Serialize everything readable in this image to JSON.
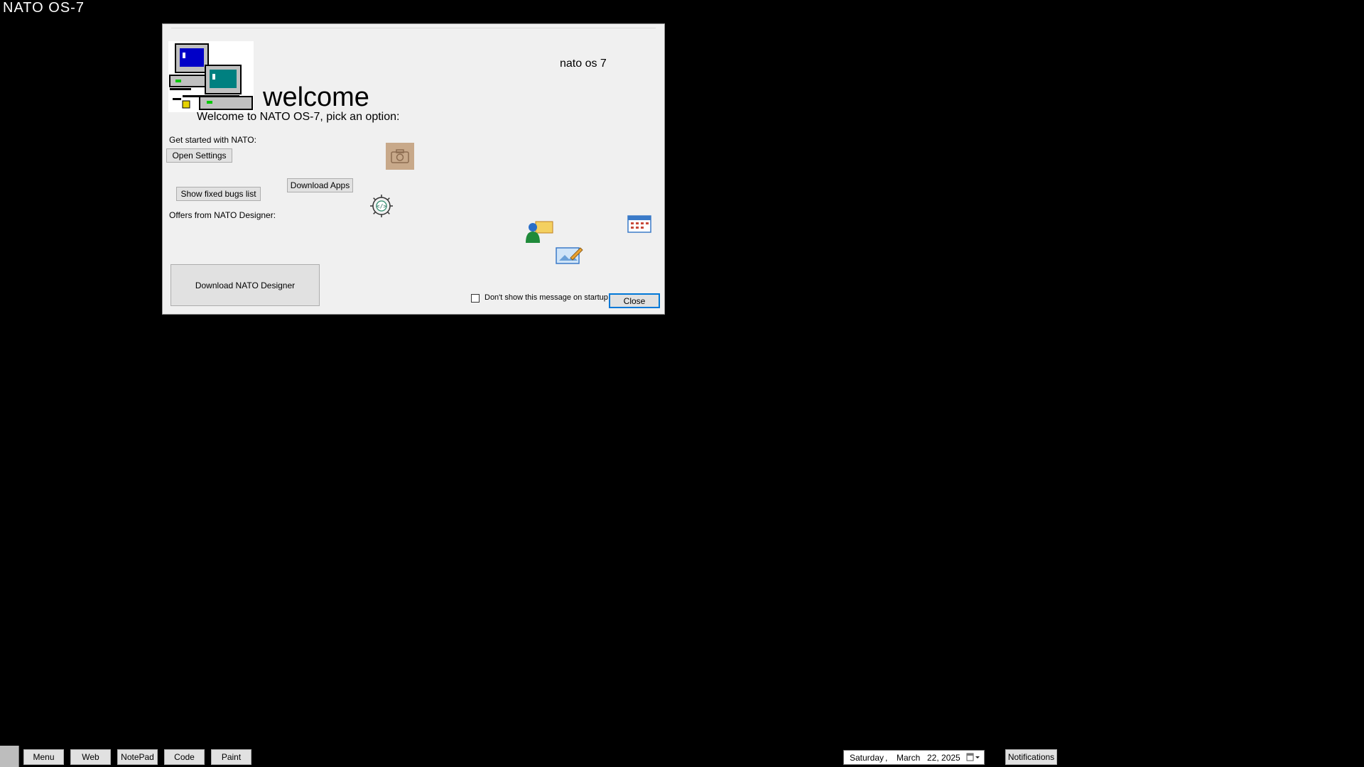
{
  "os_title": "NATO OS-7",
  "dialog": {
    "heading": "welcome",
    "subtitle": "Welcome to NATO OS-7, pick an option:",
    "brand": "nato os 7",
    "get_started_label": "Get started with NATO:",
    "open_settings": "Open Settings",
    "download_apps": "Download Apps",
    "show_fixed_bugs": "Show fixed bugs list",
    "offers_label": "Offers from NATO Designer:",
    "download_designer": "Download NATO Designer",
    "dont_show_label": "Don't show this message on startup",
    "dont_show_checked": false,
    "close": "Close",
    "icons": [
      "network-computers-icon",
      "camera-icon",
      "code-gear-icon",
      "user-presenter-icon",
      "calendar-icon",
      "edit-image-icon"
    ]
  },
  "taskbar": {
    "buttons": [
      "Menu",
      "Web",
      "NotePad",
      "Code",
      "Paint"
    ],
    "date": {
      "weekday": "Saturday",
      "sep": ",",
      "month": "March",
      "day_year": "22, 2025"
    },
    "notifications": "Notifications"
  }
}
